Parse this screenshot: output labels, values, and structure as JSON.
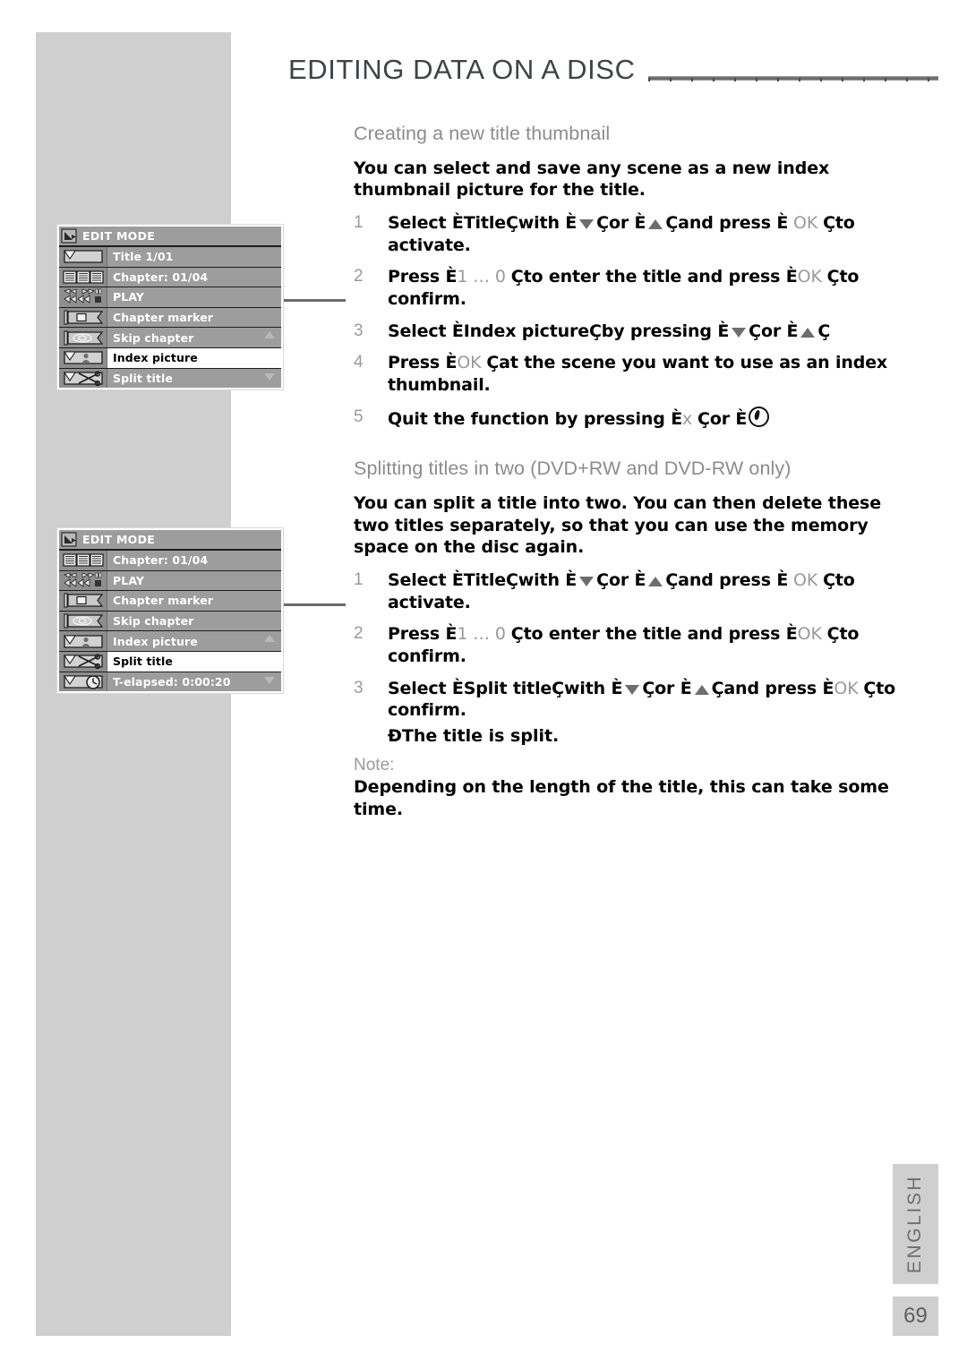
{
  "header": {
    "title": "EDITING DATA ON A DISC",
    "rule": "horizontal-rule"
  },
  "sections": [
    {
      "heading": "Creating a new title thumbnail",
      "intro": "You can select and save any scene as a new index thumbnail picture for the title.",
      "steps": [
        {
          "num": "1",
          "parts": [
            {
              "t": "text",
              "v": "Select "
            },
            {
              "t": "kb",
              "v": "È"
            },
            {
              "t": "text",
              "v": "Title"
            },
            {
              "t": "kb",
              "v": "Ç"
            },
            {
              "t": "text",
              "v": "with "
            },
            {
              "t": "kb",
              "v": "È"
            },
            {
              "t": "glyph",
              "v": "down-triangle"
            },
            {
              "t": "kb",
              "v": "Ç"
            },
            {
              "t": "text",
              "v": "or "
            },
            {
              "t": "kb",
              "v": "È"
            },
            {
              "t": "glyph",
              "v": "up-triangle"
            },
            {
              "t": "kb",
              "v": "Ç"
            },
            {
              "t": "text",
              "v": "and press "
            },
            {
              "t": "kb",
              "v": "È"
            },
            {
              "t": "grey",
              "v": " OK "
            },
            {
              "t": "kb",
              "v": "Ç"
            },
            {
              "t": "text",
              "v": "to activate."
            }
          ]
        },
        {
          "num": "2",
          "parts": [
            {
              "t": "text",
              "v": "Press "
            },
            {
              "t": "kb",
              "v": "È"
            },
            {
              "t": "grey",
              "v": "1 … 0 "
            },
            {
              "t": "kb",
              "v": "Ç"
            },
            {
              "t": "text",
              "v": "to enter the title and press "
            },
            {
              "t": "kb",
              "v": "È"
            },
            {
              "t": "grey",
              "v": "OK "
            },
            {
              "t": "kb",
              "v": "Ç"
            },
            {
              "t": "text",
              "v": "to confirm."
            }
          ]
        },
        {
          "num": "3",
          "parts": [
            {
              "t": "text",
              "v": "Select "
            },
            {
              "t": "kb",
              "v": "È"
            },
            {
              "t": "text",
              "v": "Index picture"
            },
            {
              "t": "kb",
              "v": "Ç"
            },
            {
              "t": "text",
              "v": "by pressing "
            },
            {
              "t": "kb",
              "v": "È"
            },
            {
              "t": "glyph",
              "v": "down-triangle"
            },
            {
              "t": "kb",
              "v": "Ç"
            },
            {
              "t": "text",
              "v": "or "
            },
            {
              "t": "kb",
              "v": "È"
            },
            {
              "t": "glyph",
              "v": "up-triangle"
            },
            {
              "t": "kb",
              "v": "Ç"
            }
          ]
        },
        {
          "num": "4",
          "parts": [
            {
              "t": "text",
              "v": "Press "
            },
            {
              "t": "kb",
              "v": "È"
            },
            {
              "t": "grey",
              "v": "OK "
            },
            {
              "t": "kb",
              "v": "Ç"
            },
            {
              "t": "text",
              "v": "at the scene you want to use as an index thumbnail."
            }
          ]
        },
        {
          "num": "5",
          "parts": [
            {
              "t": "text",
              "v": "Quit the function by pressing "
            },
            {
              "t": "kb",
              "v": "È"
            },
            {
              "t": "grey",
              "v": "x "
            },
            {
              "t": "kb",
              "v": "Ç"
            },
            {
              "t": "text",
              "v": "or "
            },
            {
              "t": "kb",
              "v": "È"
            },
            {
              "t": "glyph",
              "v": "standby-icon"
            }
          ]
        }
      ]
    },
    {
      "heading": "Splitting titles in two (DVD+RW and DVD-RW only)",
      "intro": "You can split a title into two. You can then delete these two titles separately, so that you can use the memory space on the disc again.",
      "steps": [
        {
          "num": "1",
          "parts": [
            {
              "t": "text",
              "v": "Select "
            },
            {
              "t": "kb",
              "v": "È"
            },
            {
              "t": "text",
              "v": "Title"
            },
            {
              "t": "kb",
              "v": "Ç"
            },
            {
              "t": "text",
              "v": "with "
            },
            {
              "t": "kb",
              "v": "È"
            },
            {
              "t": "glyph",
              "v": "down-triangle"
            },
            {
              "t": "kb",
              "v": "Ç"
            },
            {
              "t": "text",
              "v": "or "
            },
            {
              "t": "kb",
              "v": "È"
            },
            {
              "t": "glyph",
              "v": "up-triangle"
            },
            {
              "t": "kb",
              "v": "Ç"
            },
            {
              "t": "text",
              "v": "and press "
            },
            {
              "t": "kb",
              "v": "È"
            },
            {
              "t": "grey",
              "v": " OK "
            },
            {
              "t": "kb",
              "v": "Ç"
            },
            {
              "t": "text",
              "v": "to activate."
            }
          ]
        },
        {
          "num": "2",
          "parts": [
            {
              "t": "text",
              "v": "Press "
            },
            {
              "t": "kb",
              "v": "È"
            },
            {
              "t": "grey",
              "v": "1 … 0 "
            },
            {
              "t": "kb",
              "v": "Ç"
            },
            {
              "t": "text",
              "v": "to enter the title and press "
            },
            {
              "t": "kb",
              "v": "È"
            },
            {
              "t": "grey",
              "v": "OK "
            },
            {
              "t": "kb",
              "v": "Ç"
            },
            {
              "t": "text",
              "v": "to confirm."
            }
          ]
        },
        {
          "num": "3",
          "parts": [
            {
              "t": "text",
              "v": "Select "
            },
            {
              "t": "kb",
              "v": "È"
            },
            {
              "t": "text",
              "v": "Split title"
            },
            {
              "t": "kb",
              "v": "Ç"
            },
            {
              "t": "text",
              "v": "with "
            },
            {
              "t": "kb",
              "v": "È"
            },
            {
              "t": "glyph",
              "v": "down-triangle"
            },
            {
              "t": "kb",
              "v": "Ç"
            },
            {
              "t": "text",
              "v": "or "
            },
            {
              "t": "kb",
              "v": "È"
            },
            {
              "t": "glyph",
              "v": "up-triangle"
            },
            {
              "t": "kb",
              "v": "Ç"
            },
            {
              "t": "text",
              "v": "and press "
            },
            {
              "t": "kb",
              "v": "È"
            },
            {
              "t": "grey",
              "v": "OK "
            },
            {
              "t": "kb",
              "v": "Ç"
            },
            {
              "t": "text",
              "v": "to confirm."
            }
          ]
        }
      ],
      "substep": "ÐThe title is split.",
      "note_label": "Note:",
      "note_text": "Depending on the length of the title, this can take some time."
    }
  ],
  "osd_menus": [
    {
      "title": "EDIT MODE",
      "title_icon": "edit-mode-icon",
      "rows": [
        {
          "label": "Title 1/01",
          "icon": "folder-title-icon",
          "selected": false,
          "arrow": ""
        },
        {
          "label": "Chapter: 01/04",
          "icon": "chapters-book-icon",
          "selected": false,
          "arrow": ""
        },
        {
          "label": "PLAY",
          "icon": "transport-play-icon",
          "selected": false,
          "arrow": ""
        },
        {
          "label": "Chapter marker",
          "icon": "flag-marker-icon",
          "selected": false,
          "arrow": ""
        },
        {
          "label": "Skip chapter",
          "icon": "flag-eye-icon",
          "selected": false,
          "arrow": "up"
        },
        {
          "label": "Index picture",
          "icon": "folder-person-icon",
          "selected": true,
          "arrow": ""
        },
        {
          "label": "Split title",
          "icon": "folder-scissors-icon",
          "selected": false,
          "arrow": "down"
        }
      ]
    },
    {
      "title": "EDIT MODE",
      "title_icon": "edit-mode-icon",
      "rows": [
        {
          "label": "Chapter: 01/04",
          "icon": "chapters-book-icon",
          "selected": false,
          "arrow": ""
        },
        {
          "label": "PLAY",
          "icon": "transport-play-icon",
          "selected": false,
          "arrow": ""
        },
        {
          "label": "Chapter marker",
          "icon": "flag-marker-icon",
          "selected": false,
          "arrow": ""
        },
        {
          "label": "Skip chapter",
          "icon": "flag-eye-icon",
          "selected": false,
          "arrow": ""
        },
        {
          "label": "Index picture",
          "icon": "folder-person-icon",
          "selected": false,
          "arrow": "up"
        },
        {
          "label": "Split title",
          "icon": "folder-scissors-icon",
          "selected": true,
          "arrow": ""
        },
        {
          "label": "T-elapsed: 0:00:20",
          "icon": "folder-clock-icon",
          "selected": false,
          "arrow": "down"
        }
      ]
    }
  ],
  "footer": {
    "language": "ENGLISH",
    "page_number": "69"
  },
  "colors": {
    "band": "#cfcfcf",
    "heading_grey": "#8c8c8c",
    "osd_row": "#9d9d9d",
    "osd_icon": "#8e8e8e",
    "title_dark": "#3d4444"
  }
}
